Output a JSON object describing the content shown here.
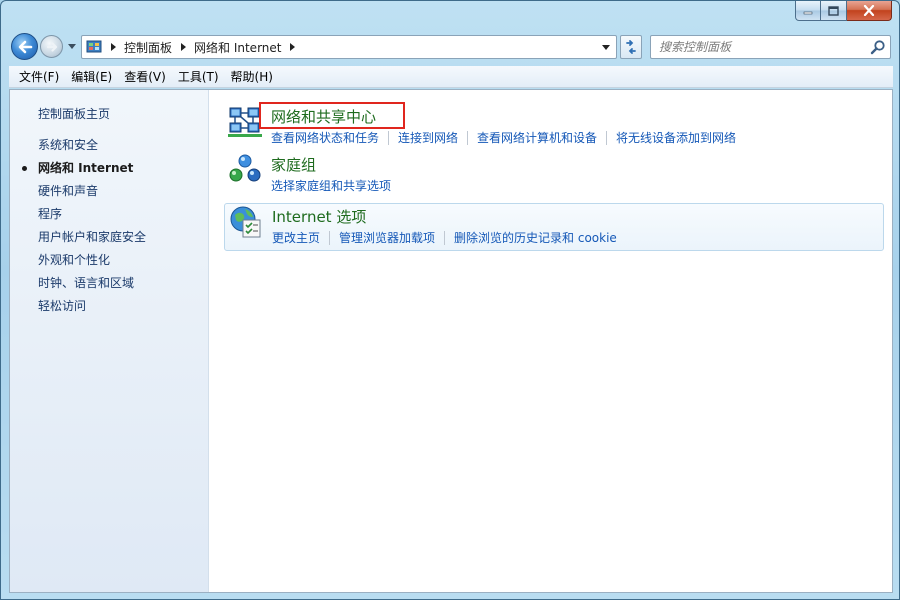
{
  "window": {
    "caption_buttons": [
      "minimize-icon",
      "maximize-icon",
      "close-icon"
    ]
  },
  "nav": {
    "breadcrumb": [
      "控制面板",
      "网络和 Internet"
    ],
    "search_placeholder": "搜索控制面板"
  },
  "menu": [
    "文件(F)",
    "编辑(E)",
    "查看(V)",
    "工具(T)",
    "帮助(H)"
  ],
  "sidebar": {
    "home": "控制面板主页",
    "items": [
      "系统和安全",
      "网络和 Internet",
      "硬件和声音",
      "程序",
      "用户帐户和家庭安全",
      "外观和个性化",
      "时钟、语言和区域",
      "轻松访问"
    ],
    "active_index": 1
  },
  "categories": [
    {
      "title": "网络和共享中心",
      "icon": "network-sharing-icon",
      "links": [
        "查看网络状态和任务",
        "连接到网络",
        "查看网络计算机和设备",
        "将无线设备添加到网络"
      ]
    },
    {
      "title": "家庭组",
      "icon": "homegroup-icon",
      "links": [
        "选择家庭组和共享选项"
      ]
    },
    {
      "title": "Internet 选项",
      "icon": "internet-options-icon",
      "links": [
        "更改主页",
        "管理浏览器加载项",
        "删除浏览的历史记录和 cookie"
      ]
    }
  ],
  "colors": {
    "link": "#1558b7",
    "category_title": "#1e6b1e",
    "highlight_box": "#e0261e"
  }
}
